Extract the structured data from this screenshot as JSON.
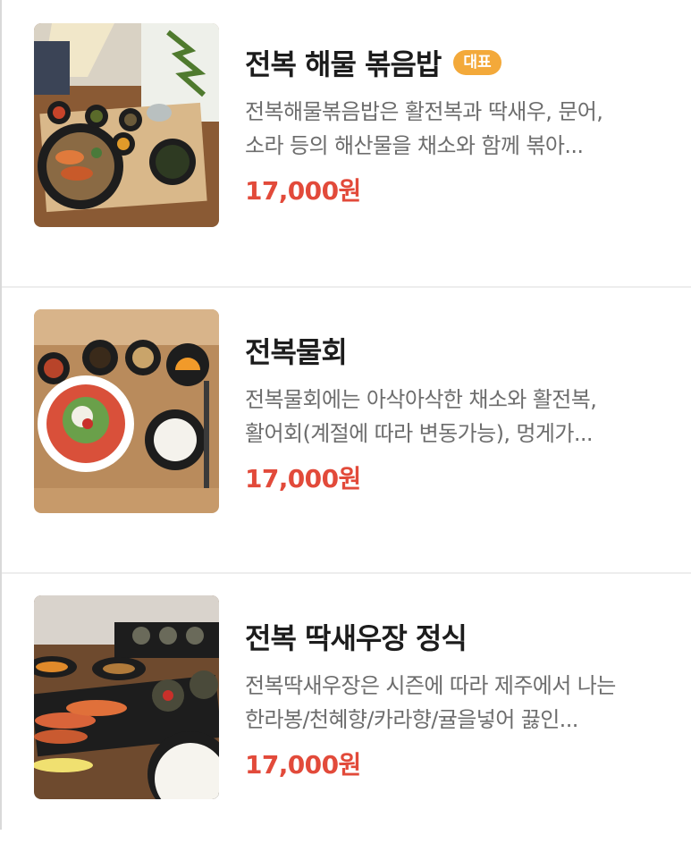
{
  "menu": {
    "items": [
      {
        "name": "전복 해물 볶음밥",
        "badge": "대표",
        "desc_line1": "전복해물볶음밥은 활전복과 딱새우, 문어,",
        "desc_line2": "소라 등의 해산물을 채소와 함께 볶아...",
        "price": "17,000원"
      },
      {
        "name": "전복물회",
        "desc_line1": "전복물회에는 아삭아삭한 채소와 활전복,",
        "desc_line2": "활어회(계절에 따라 변동가능), 멍게가...",
        "price": "17,000원"
      },
      {
        "name": "전복 딱새우장 정식",
        "desc_line1": "전복딱새우장은 시즌에 따라 제주에서 나는",
        "desc_line2": "한라봉/천혜향/카라향/귤을넣어 끓인...",
        "price": "17,000원"
      }
    ]
  },
  "colors": {
    "badge": "#f3a93a",
    "price": "#e24a3a",
    "title": "#1c1c1c",
    "desc": "#6d6d6d",
    "divider": "#ededed"
  }
}
